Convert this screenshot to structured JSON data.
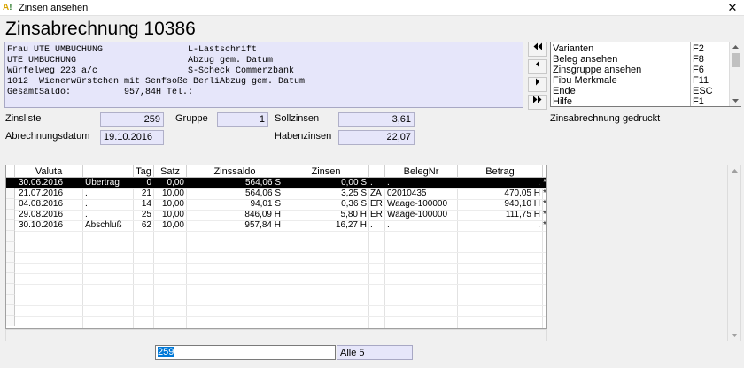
{
  "window": {
    "title": "Zinsen ansehen",
    "close": "✕"
  },
  "heading": "Zinsabrechnung 10386",
  "address": {
    "lines": [
      "Frau UTE UMBUCHUNG                L-Lastschrift",
      "UTE UMBUCHUNG                     Abzug gem. Datum",
      "Würfelweg 223 a/c                 S-Scheck Commerzbank",
      "1012  Wienerwürstchen mit Senfsoße BerliAbzug gem. Datum",
      "GesamtSaldo:          957,84H Tel.:"
    ]
  },
  "nav": {
    "first": "▶◀",
    "prev": "◀",
    "next": "▶",
    "last": "▶▶"
  },
  "menu": {
    "items": [
      {
        "label": "Varianten",
        "key": "F2"
      },
      {
        "label": "Beleg ansehen",
        "key": "F8"
      },
      {
        "label": "Zinsgruppe ansehen",
        "key": "F6"
      },
      {
        "label": "Fibu Merkmale",
        "key": "F11"
      },
      {
        "label": "Ende",
        "key": "ESC"
      },
      {
        "label": "Hilfe",
        "key": "F1"
      }
    ]
  },
  "fields": {
    "zinsliste_label": "Zinsliste",
    "zinsliste": "259",
    "gruppe_label": "Gruppe",
    "gruppe": "1",
    "sollzinsen_label": "Sollzinsen",
    "sollzinsen": "3,61",
    "abrechnungsdatum_label": "Abrechnungsdatum",
    "abrechnungsdatum": "19.10.2016",
    "habenzinsen_label": "Habenzinsen",
    "habenzinsen": "22,07",
    "status": "Zinsabrechnung gedruckt"
  },
  "table": {
    "headers": [
      "Valuta",
      "",
      "Tag",
      "Satz",
      "Zinssaldo",
      "Zinsen",
      "",
      "BelegNr",
      "Betrag",
      ""
    ],
    "rows": [
      [
        "30.06.2016",
        "Übertrag",
        "0",
        "0,00",
        "564,06 S",
        "0,00 S",
        ".",
        ".",
        ".",
        "*"
      ],
      [
        "21.07.2016",
        ".",
        "21",
        "10,00",
        "564,06 S",
        "3,25 S",
        "ZA",
        "02010435",
        "470,05 H",
        "*"
      ],
      [
        "04.08.2016",
        ".",
        "14",
        "10,00",
        "94,01 S",
        "0,36 S",
        "ER",
        "Waage-100000",
        "940,10 H",
        "*"
      ],
      [
        "29.08.2016",
        ".",
        "25",
        "10,00",
        "846,09 H",
        "5,80 H",
        "ER",
        "Waage-100000",
        "111,75 H",
        "*"
      ],
      [
        "30.10.2016",
        "Abschluß",
        "62",
        "10,00",
        "957,84 H",
        "16,27 H",
        ".",
        ".",
        ".",
        "*"
      ]
    ]
  },
  "bottom": {
    "input": "259",
    "alle": "Alle 5"
  }
}
